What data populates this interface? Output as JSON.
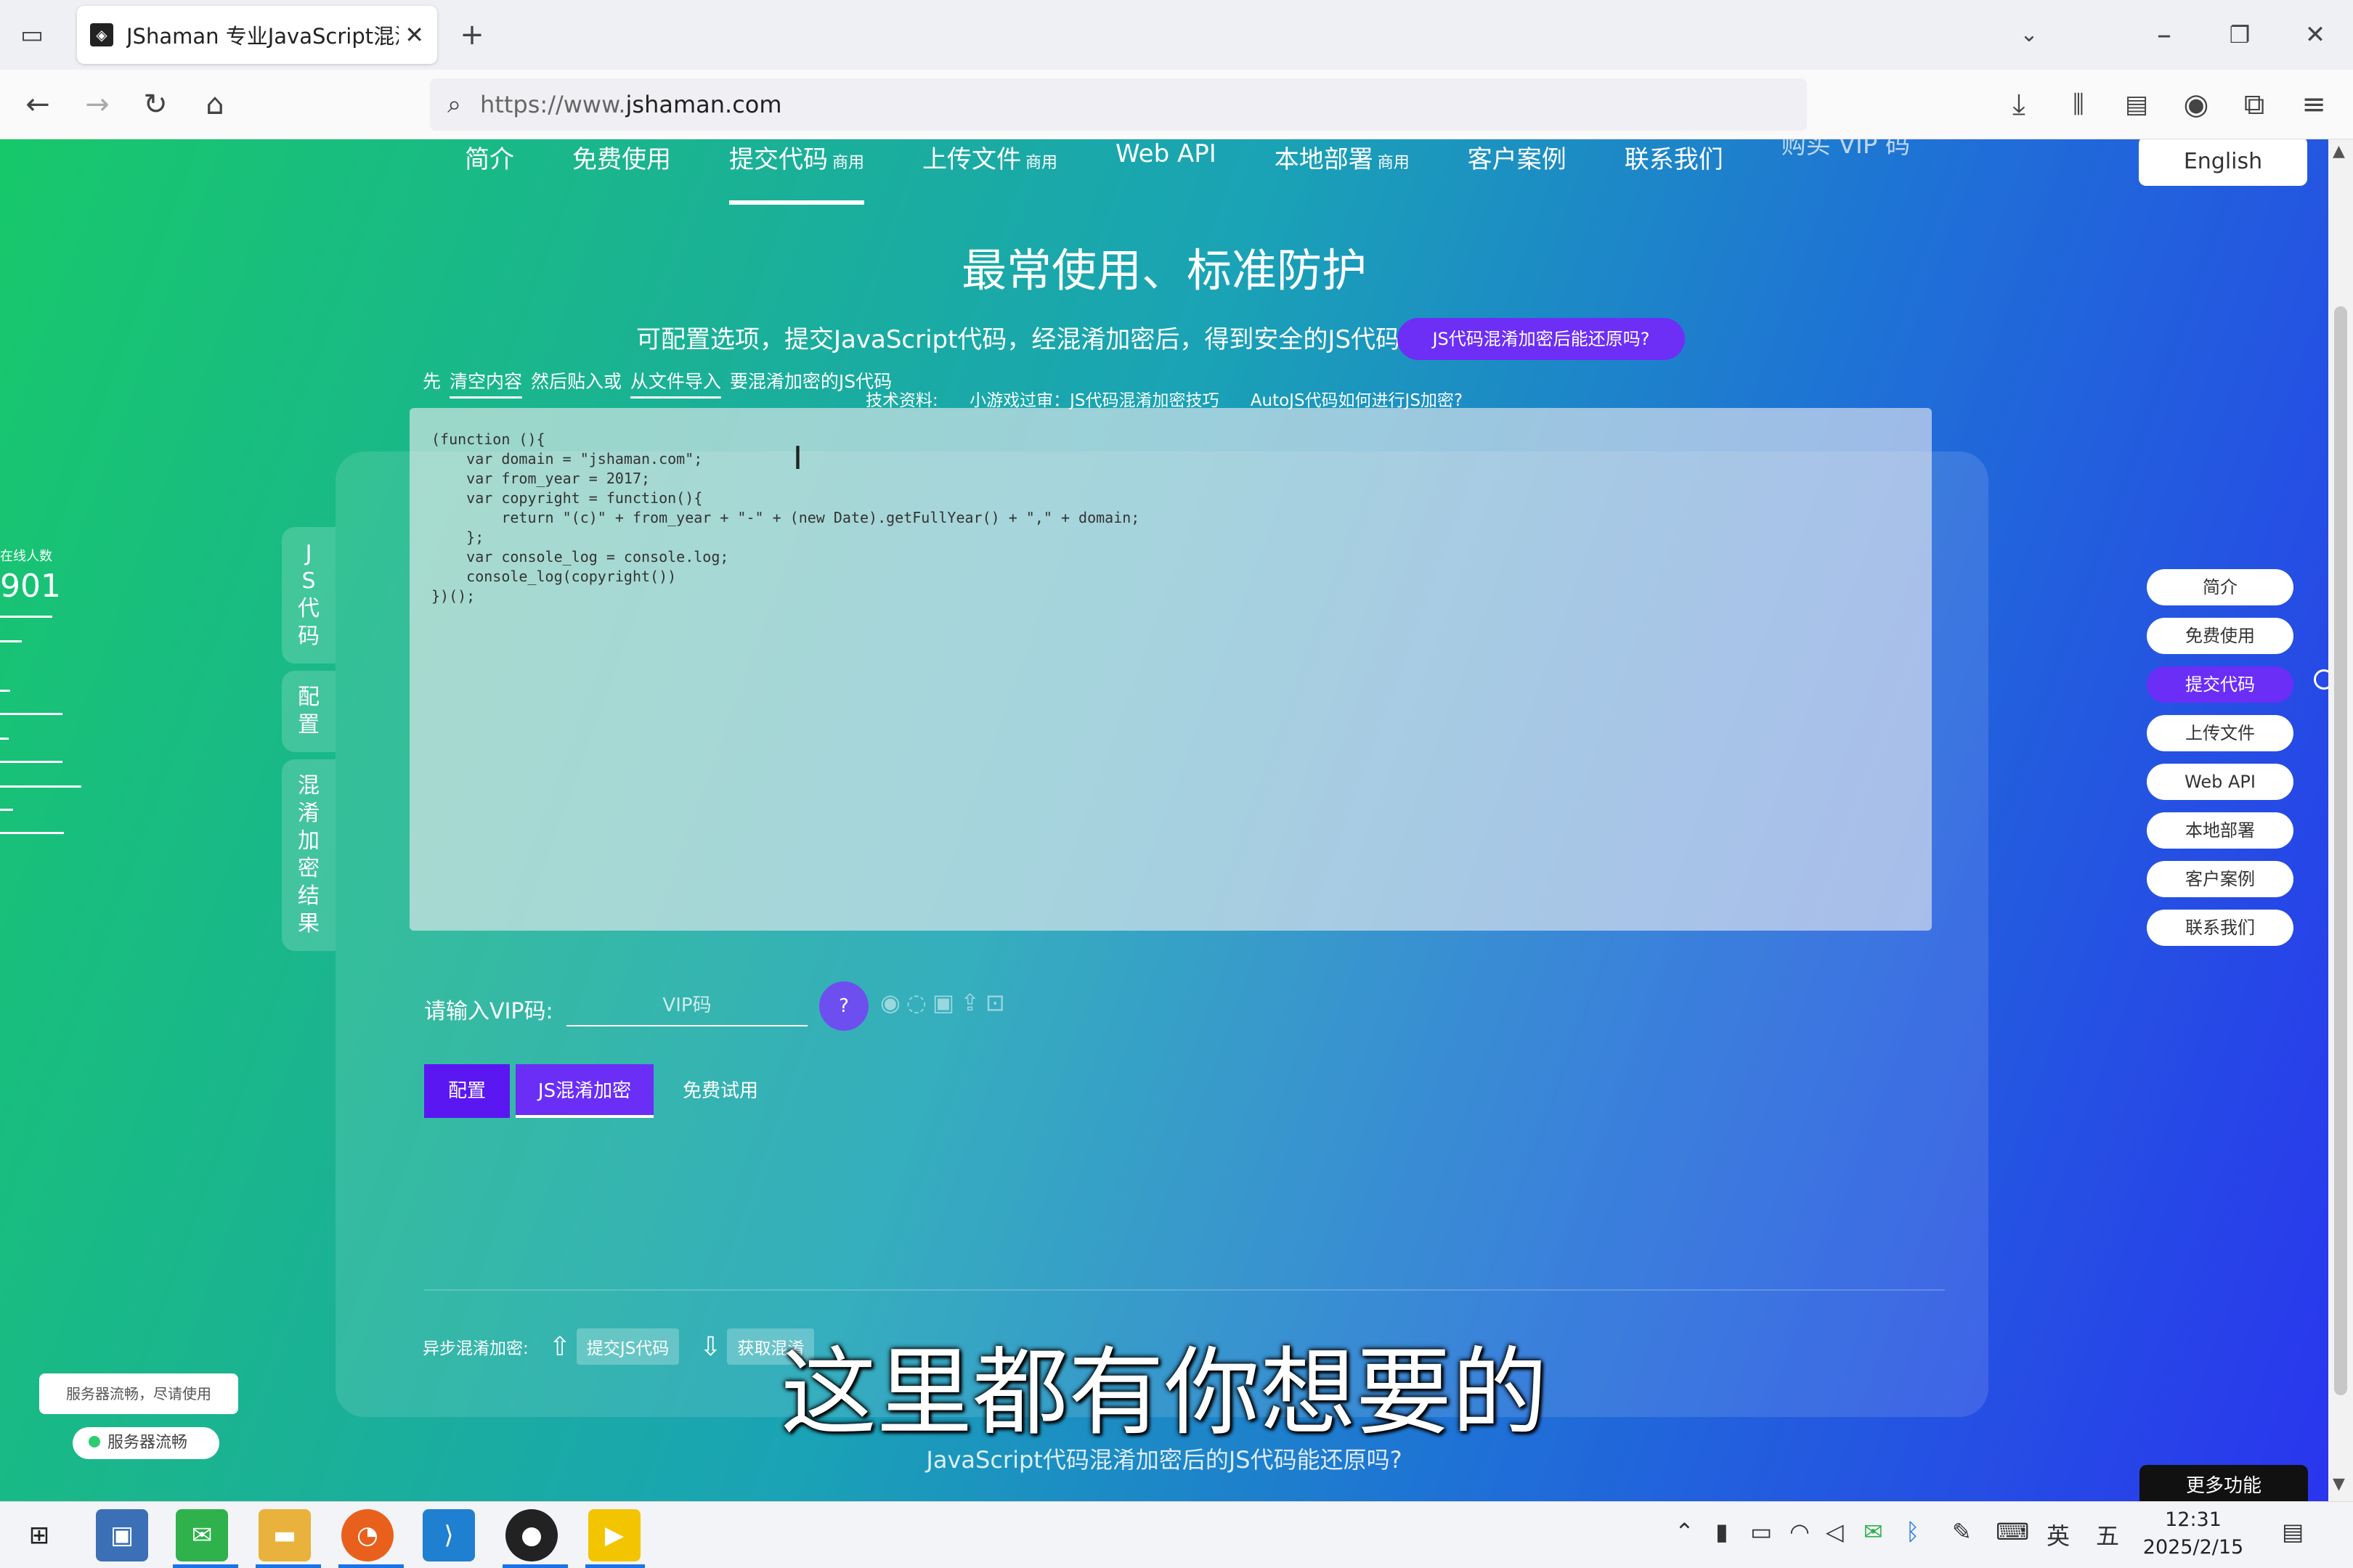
{
  "browser": {
    "tab_title": "JShaman 专业JavaScript混淆加",
    "url_prefix": "https://www.",
    "url_domain": "jshaman.com"
  },
  "nav": {
    "items": [
      {
        "label": "简介",
        "tag": ""
      },
      {
        "label": "免费使用",
        "tag": ""
      },
      {
        "label": "提交代码",
        "tag": "商用"
      },
      {
        "label": "上传文件",
        "tag": "商用"
      },
      {
        "label": "Web API",
        "tag": ""
      },
      {
        "label": "本地部署",
        "tag": "商用"
      },
      {
        "label": "客户案例",
        "tag": ""
      },
      {
        "label": "联系我们",
        "tag": ""
      },
      {
        "label": "购买 VIP 码",
        "tag": ""
      }
    ],
    "language": "English"
  },
  "hero": {
    "headline": "最常使用、标准防护",
    "subline": "可配置选项，提交JavaScript代码，经混淆加密后，得到安全的JS代码。",
    "restore_button": "JS代码混淆加密后能还原吗?",
    "tech_label": "技术资料:",
    "tech_link1": "小游戏过审：JS代码混淆加密技巧",
    "tech_link2": "AutoJS代码如何进行JS加密?"
  },
  "editor": {
    "hint_pre": "先",
    "hint_clear": "清空内容",
    "hint_mid": "然后贴入或",
    "hint_import": "从文件导入",
    "hint_post": "要混淆加密的JS代码",
    "code": "(function (){\n    var domain = \"jshaman.com\";\n    var from_year = 2017;\n    var copyright = function(){\n        return \"(c)\" + from_year + \"-\" + (new Date).getFullYear() + \",\" + domain;\n    };\n    var console_log = console.log;\n    console_log(copyright())\n})();"
  },
  "side_tabs": [
    "JS代码",
    "配置",
    "混淆加密结果"
  ],
  "online": {
    "label": "在线人数",
    "count": "901"
  },
  "vip": {
    "label": "请输入VIP码:",
    "placeholder": "VIP码",
    "help": "?"
  },
  "actions": {
    "config": "配置",
    "obfuscate": "JS混淆加密",
    "free_trial": "免费试用"
  },
  "async": {
    "label": "异步混淆加密:",
    "submit": "提交JS代码",
    "fetch": "获取混淆"
  },
  "caption": "这里都有你想要的",
  "bottom_question": "JavaScript代码混淆加密后的JS代码能还原吗?",
  "server": {
    "bubble": "服务器流畅，尽请使用",
    "status": "服务器流畅"
  },
  "right_nav": [
    "简介",
    "免费使用",
    "提交代码",
    "上传文件",
    "Web API",
    "本地部署",
    "客户案例",
    "联系我们"
  ],
  "right_nav_active": 2,
  "more_button": "更多功能",
  "taskbar": {
    "ime": "英",
    "ime2": "五",
    "time": "12:31",
    "date": "2025/2/15"
  },
  "colors": {
    "accent_purple": "#6b2ef7",
    "grad_start": "#17c86a",
    "grad_end": "#2a35ee"
  }
}
